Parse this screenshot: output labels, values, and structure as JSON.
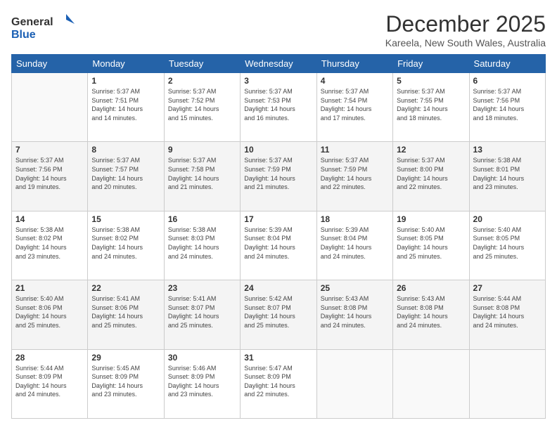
{
  "header": {
    "logo_line1": "General",
    "logo_line2": "Blue",
    "month": "December 2025",
    "location": "Kareela, New South Wales, Australia"
  },
  "days_of_week": [
    "Sunday",
    "Monday",
    "Tuesday",
    "Wednesday",
    "Thursday",
    "Friday",
    "Saturday"
  ],
  "weeks": [
    [
      {
        "day": "",
        "info": ""
      },
      {
        "day": "1",
        "info": "Sunrise: 5:37 AM\nSunset: 7:51 PM\nDaylight: 14 hours\nand 14 minutes."
      },
      {
        "day": "2",
        "info": "Sunrise: 5:37 AM\nSunset: 7:52 PM\nDaylight: 14 hours\nand 15 minutes."
      },
      {
        "day": "3",
        "info": "Sunrise: 5:37 AM\nSunset: 7:53 PM\nDaylight: 14 hours\nand 16 minutes."
      },
      {
        "day": "4",
        "info": "Sunrise: 5:37 AM\nSunset: 7:54 PM\nDaylight: 14 hours\nand 17 minutes."
      },
      {
        "day": "5",
        "info": "Sunrise: 5:37 AM\nSunset: 7:55 PM\nDaylight: 14 hours\nand 18 minutes."
      },
      {
        "day": "6",
        "info": "Sunrise: 5:37 AM\nSunset: 7:56 PM\nDaylight: 14 hours\nand 18 minutes."
      }
    ],
    [
      {
        "day": "7",
        "info": "Sunrise: 5:37 AM\nSunset: 7:56 PM\nDaylight: 14 hours\nand 19 minutes."
      },
      {
        "day": "8",
        "info": "Sunrise: 5:37 AM\nSunset: 7:57 PM\nDaylight: 14 hours\nand 20 minutes."
      },
      {
        "day": "9",
        "info": "Sunrise: 5:37 AM\nSunset: 7:58 PM\nDaylight: 14 hours\nand 21 minutes."
      },
      {
        "day": "10",
        "info": "Sunrise: 5:37 AM\nSunset: 7:59 PM\nDaylight: 14 hours\nand 21 minutes."
      },
      {
        "day": "11",
        "info": "Sunrise: 5:37 AM\nSunset: 7:59 PM\nDaylight: 14 hours\nand 22 minutes."
      },
      {
        "day": "12",
        "info": "Sunrise: 5:37 AM\nSunset: 8:00 PM\nDaylight: 14 hours\nand 22 minutes."
      },
      {
        "day": "13",
        "info": "Sunrise: 5:38 AM\nSunset: 8:01 PM\nDaylight: 14 hours\nand 23 minutes."
      }
    ],
    [
      {
        "day": "14",
        "info": "Sunrise: 5:38 AM\nSunset: 8:02 PM\nDaylight: 14 hours\nand 23 minutes."
      },
      {
        "day": "15",
        "info": "Sunrise: 5:38 AM\nSunset: 8:02 PM\nDaylight: 14 hours\nand 24 minutes."
      },
      {
        "day": "16",
        "info": "Sunrise: 5:38 AM\nSunset: 8:03 PM\nDaylight: 14 hours\nand 24 minutes."
      },
      {
        "day": "17",
        "info": "Sunrise: 5:39 AM\nSunset: 8:04 PM\nDaylight: 14 hours\nand 24 minutes."
      },
      {
        "day": "18",
        "info": "Sunrise: 5:39 AM\nSunset: 8:04 PM\nDaylight: 14 hours\nand 24 minutes."
      },
      {
        "day": "19",
        "info": "Sunrise: 5:40 AM\nSunset: 8:05 PM\nDaylight: 14 hours\nand 25 minutes."
      },
      {
        "day": "20",
        "info": "Sunrise: 5:40 AM\nSunset: 8:05 PM\nDaylight: 14 hours\nand 25 minutes."
      }
    ],
    [
      {
        "day": "21",
        "info": "Sunrise: 5:40 AM\nSunset: 8:06 PM\nDaylight: 14 hours\nand 25 minutes."
      },
      {
        "day": "22",
        "info": "Sunrise: 5:41 AM\nSunset: 8:06 PM\nDaylight: 14 hours\nand 25 minutes."
      },
      {
        "day": "23",
        "info": "Sunrise: 5:41 AM\nSunset: 8:07 PM\nDaylight: 14 hours\nand 25 minutes."
      },
      {
        "day": "24",
        "info": "Sunrise: 5:42 AM\nSunset: 8:07 PM\nDaylight: 14 hours\nand 25 minutes."
      },
      {
        "day": "25",
        "info": "Sunrise: 5:43 AM\nSunset: 8:08 PM\nDaylight: 14 hours\nand 24 minutes."
      },
      {
        "day": "26",
        "info": "Sunrise: 5:43 AM\nSunset: 8:08 PM\nDaylight: 14 hours\nand 24 minutes."
      },
      {
        "day": "27",
        "info": "Sunrise: 5:44 AM\nSunset: 8:08 PM\nDaylight: 14 hours\nand 24 minutes."
      }
    ],
    [
      {
        "day": "28",
        "info": "Sunrise: 5:44 AM\nSunset: 8:09 PM\nDaylight: 14 hours\nand 24 minutes."
      },
      {
        "day": "29",
        "info": "Sunrise: 5:45 AM\nSunset: 8:09 PM\nDaylight: 14 hours\nand 23 minutes."
      },
      {
        "day": "30",
        "info": "Sunrise: 5:46 AM\nSunset: 8:09 PM\nDaylight: 14 hours\nand 23 minutes."
      },
      {
        "day": "31",
        "info": "Sunrise: 5:47 AM\nSunset: 8:09 PM\nDaylight: 14 hours\nand 22 minutes."
      },
      {
        "day": "",
        "info": ""
      },
      {
        "day": "",
        "info": ""
      },
      {
        "day": "",
        "info": ""
      }
    ]
  ]
}
